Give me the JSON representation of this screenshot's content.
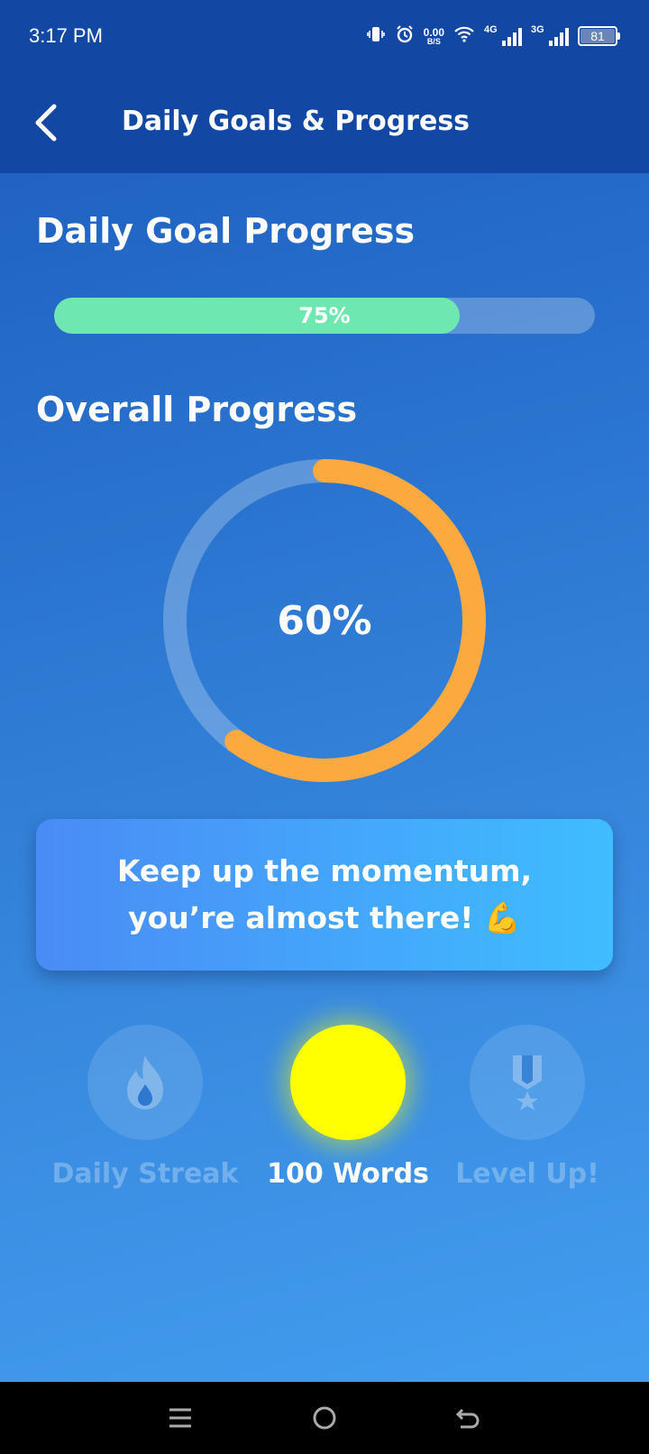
{
  "status_bar": {
    "time": "3:17 PM",
    "net_speed_value": "0.00",
    "net_speed_unit": "B/S",
    "signal_1_label": "4G",
    "signal_2_label": "3G",
    "battery_level": "81",
    "icons": [
      "vibrate-icon",
      "alarm-icon",
      "wifi-icon",
      "signal-icon",
      "battery-icon"
    ]
  },
  "header": {
    "title": "Daily Goals & Progress",
    "back_icon": "chevron-left-icon"
  },
  "daily_goal": {
    "title": "Daily Goal Progress",
    "percent": 75,
    "label": "75%",
    "fill_color": "#6ee8b0"
  },
  "overall": {
    "title": "Overall Progress",
    "percent": 60,
    "label": "60%",
    "ring_color": "#fca93f"
  },
  "message": {
    "line1": "Keep up the momentum,",
    "line2": "you’re almost there!",
    "emoji": "💪"
  },
  "badges": [
    {
      "label": "Daily Streak",
      "icon": "fire-icon",
      "state": "locked"
    },
    {
      "label": "100 Words",
      "icon": "none",
      "state": "active"
    },
    {
      "label": "Level Up!",
      "icon": "medal-icon",
      "state": "locked"
    }
  ],
  "nav": {
    "icons": [
      "menu-icon",
      "home-icon",
      "back-icon"
    ]
  }
}
